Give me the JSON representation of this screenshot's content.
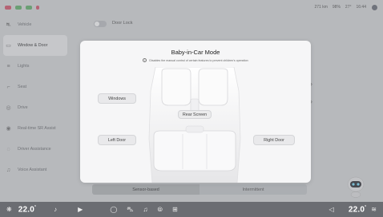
{
  "statusbar": {
    "range": "271 km",
    "battery": "98%",
    "weather": "27°",
    "time": "16:44"
  },
  "sidebar": {
    "items": [
      {
        "label": "Vehicle",
        "icon": "car-icon"
      },
      {
        "label": "Window & Door",
        "icon": "window-icon"
      },
      {
        "label": "Lights",
        "icon": "lights-icon"
      },
      {
        "label": "Seat",
        "icon": "seat-icon"
      },
      {
        "label": "Drive",
        "icon": "steering-icon"
      },
      {
        "label": "Real-time SR Assist",
        "icon": "sr-assist-icon"
      },
      {
        "label": "Driver Assistance",
        "icon": "driver-assist-icon"
      },
      {
        "label": "Voice Assistant",
        "icon": "voice-icon"
      }
    ]
  },
  "main": {
    "door_lock_label": "Door Lock",
    "segments": [
      "Sensor-based",
      "Intermittent"
    ]
  },
  "modal": {
    "title": "Baby-in-Car Mode",
    "subtitle": "Disables the manual control of certain features to prevent children's operation",
    "buttons": {
      "windows": "Windows",
      "rear_screen": "Rear Screen",
      "left_door": "Left Door",
      "right_door": "Right Door"
    }
  },
  "dock": {
    "left_temp": "22.0",
    "right_temp": "22.0",
    "temp_unit": "°"
  },
  "colors": {
    "modal_bg": "#f6f6f7",
    "dock_bg": "#6b6d72"
  }
}
